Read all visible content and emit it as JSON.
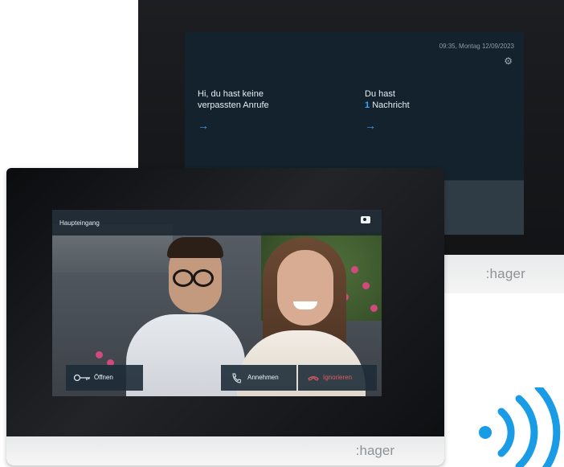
{
  "back_device": {
    "datetime": "09:35, Montag 12/09/2023",
    "settings_icon": "gear-icon",
    "missed_calls": {
      "line1": "Hi, du hast keine",
      "line2": "verpassten Anrufe",
      "arrow": "→"
    },
    "messages": {
      "line1": "Du hast",
      "count": "1",
      "label": "Nachricht",
      "arrow": "→"
    },
    "tile_left_icon": "key-icon",
    "tile_right_icon": "muted-bell-icon",
    "brand": ":hager"
  },
  "front_device": {
    "location": "Haupteingang",
    "snapshot_icon": "camera-icon",
    "buttons": {
      "open": {
        "label": "Öffnen",
        "icon": "key-icon"
      },
      "accept": {
        "label": "Annehmen",
        "icon": "phone-icon"
      },
      "ignore": {
        "label": "Ignorieren",
        "icon": "hang-up-icon"
      }
    },
    "brand": ":hager"
  },
  "colors": {
    "accent_blue": "#3aa6ff",
    "decline_red": "#e35d62",
    "wireless_blue": "#1a9be6"
  }
}
